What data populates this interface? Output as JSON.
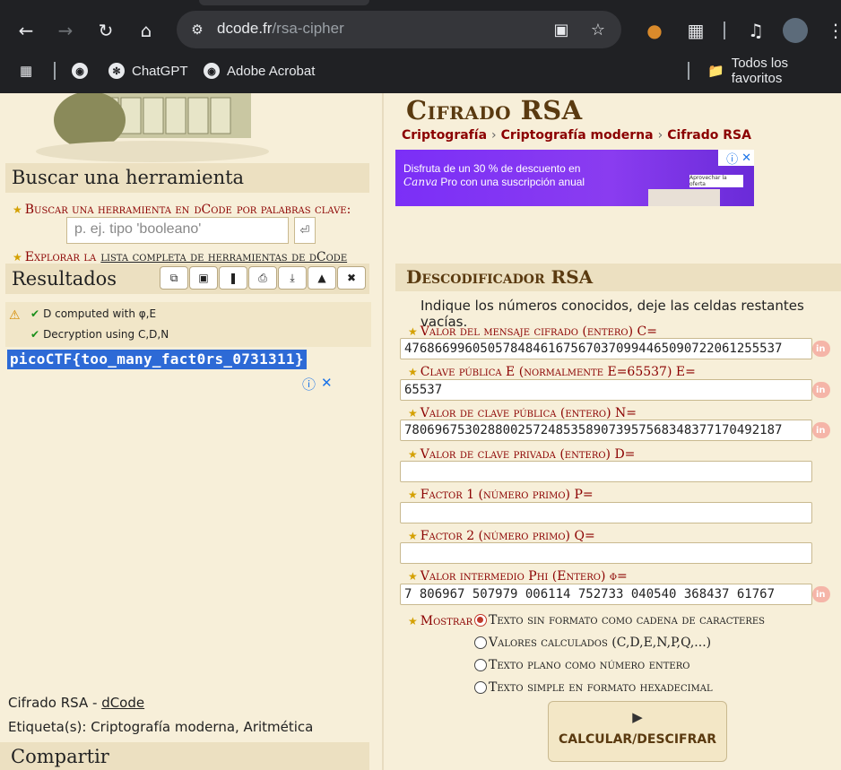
{
  "browser": {
    "url_host": "dcode.fr",
    "url_path": "/rsa-cipher",
    "bookmarks": [
      {
        "label": "ChatGPT"
      },
      {
        "label": "Adobe Acrobat"
      }
    ],
    "all_bookmarks": "Todos los favoritos"
  },
  "left": {
    "search_title": "Buscar una herramienta",
    "search_prompt_prefix": "Buscar una herramienta en",
    "search_prompt_site": "dCode",
    "search_prompt_suffix": "por palabras clave:",
    "search_placeholder": "p. ej. tipo 'booleano'",
    "explore_prefix": "Explorar la",
    "explore_link": "lista completa de herramientas de dCode",
    "results_title": "Resultados",
    "results": [
      {
        "text": "D computed with φ,E"
      },
      {
        "text": "Decryption using C,D,N"
      }
    ],
    "flag": "picoCTF{too_many_fact0rs_0731311}",
    "footer_prefix": "Cifrado RSA - ",
    "footer_link": "dCode",
    "tags": "Etiqueta(s): Criptografía moderna, Aritmética",
    "share_title": "Compartir"
  },
  "right": {
    "page_title": "Cifrado RSA",
    "breadcrumbs": [
      "Criptografía",
      "Criptografía moderna",
      "Cifrado RSA"
    ],
    "ad": {
      "line1": "Disfruta de un 30 % de descuento en",
      "line2_brand": "Canva",
      "line2_rest": " Pro con una suscripción anual",
      "cta": "Aprovechar la oferta",
      "colors": {
        "bg": "#7b2ff7"
      }
    },
    "decoder_title": "Descodificador RSA",
    "instructions": "Indique los números conocidos, deje las celdas restantes vacías.",
    "fields": [
      {
        "label": "Valor del mensaje cifrado (entero) C=",
        "value": "47686699605057848461675670370994465090722061255537"
      },
      {
        "label": "Clave pública E (normalmente E=65537) E=",
        "value": "65537"
      },
      {
        "label": "Valor de clave pública (entero) N=",
        "value": "78069675302880025724853589073957568348377170492187"
      },
      {
        "label": "Valor de clave privada (entero) D=",
        "value": ""
      },
      {
        "label": "Factor 1 (número primo) P=",
        "value": ""
      },
      {
        "label": "Factor 2 (número primo) Q=",
        "value": ""
      },
      {
        "label": "Valor intermedio Phi (Entero) φ=",
        "value": "7 806967 507979 006114 752733 040540 368437 61767"
      }
    ],
    "show_label": "Mostrar",
    "show_options": [
      {
        "label": "Texto sin formato como cadena de caracteres",
        "selected": true
      },
      {
        "label": "Valores calculados (C,D,E,N,P,Q,...)",
        "selected": false
      },
      {
        "label": "Texto plano como número entero",
        "selected": false
      },
      {
        "label": "Texto simple en formato hexadecimal",
        "selected": false
      }
    ],
    "calc_button": "Calcular/Descifrar"
  }
}
